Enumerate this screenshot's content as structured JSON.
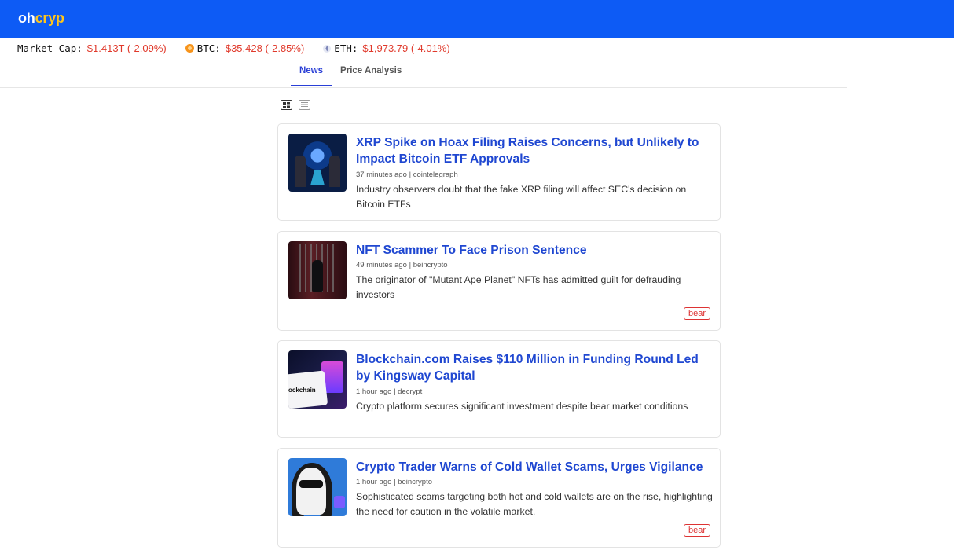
{
  "brand": {
    "prefix": "oh",
    "suffix": "cryp"
  },
  "ticker": {
    "market_cap_label": "Market Cap:",
    "market_cap_value": "$1.413T (-2.09%)",
    "btc_label": "BTC:",
    "btc_value": "$35,428 (-2.85%)",
    "eth_label": "ETH:",
    "eth_value": "$1,973.79 (-4.01%)"
  },
  "tabs": [
    {
      "label": "News",
      "active": true
    },
    {
      "label": "Price Analysis",
      "active": false
    }
  ],
  "articles": [
    {
      "title": "XRP Spike on Hoax Filing Raises Concerns, but Unlikely to Impact Bitcoin ETF Approvals",
      "meta": "37 minutes ago | cointelegraph",
      "description": "Industry observers doubt that the fake XRP filing will affect SEC's decision on Bitcoin ETFs",
      "badge": ""
    },
    {
      "title": "NFT Scammer To Face Prison Sentence",
      "meta": "49 minutes ago | beincrypto",
      "description": "The originator of \"Mutant Ape Planet\" NFTs has admitted guilt for defrauding investors",
      "badge": "bear"
    },
    {
      "title": "Blockchain.com Raises $110 Million in Funding Round Led by Kingsway Capital",
      "meta": "1 hour ago | decrypt",
      "description": "Crypto platform secures significant investment despite bear market conditions",
      "badge": "",
      "thumb_text": "ockchain"
    },
    {
      "title": "Crypto Trader Warns of Cold Wallet Scams, Urges Vigilance",
      "meta": "1 hour ago | beincrypto",
      "description": "Sophisticated scams targeting both hot and cold wallets are on the rise, highlighting the need for caution in the volatile market.",
      "badge": "bear"
    }
  ]
}
